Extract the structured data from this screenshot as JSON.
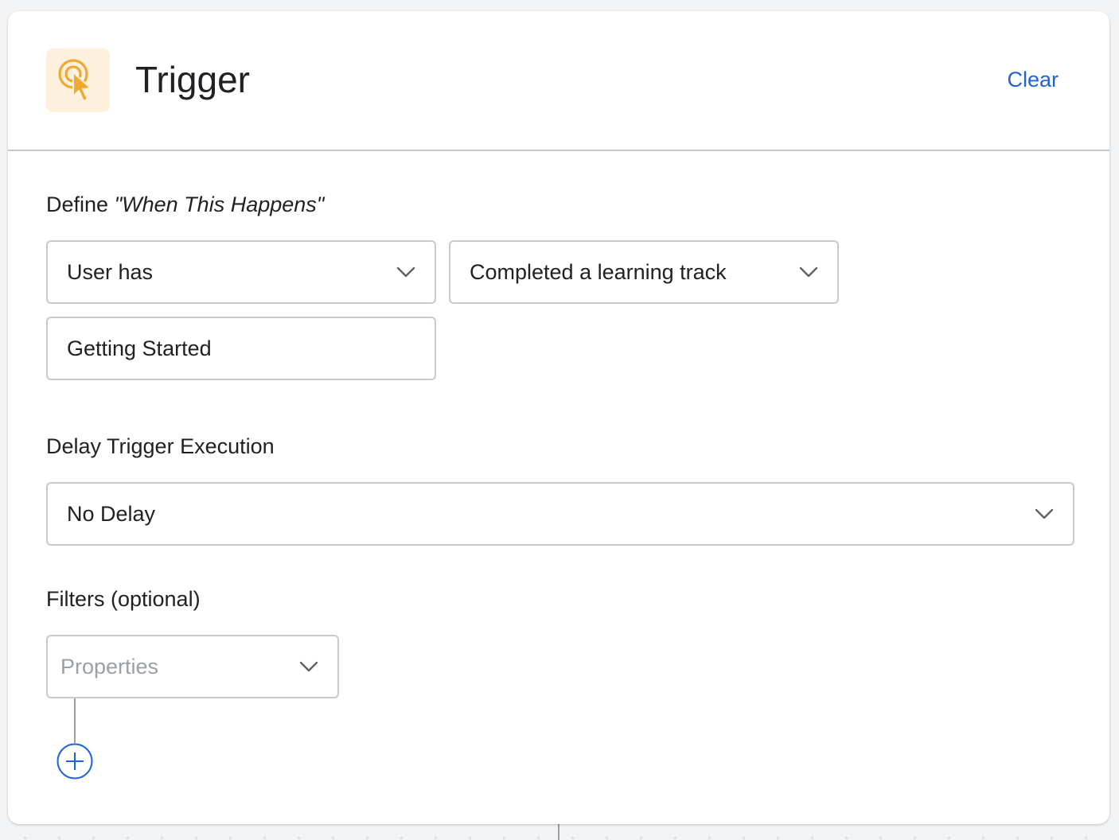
{
  "header": {
    "title": "Trigger",
    "clear_label": "Clear",
    "icon": "trigger-cursor-icon",
    "icon_color": "#f0a830",
    "icon_bg": "#fdf1dd"
  },
  "when_section": {
    "label_prefix": "Define ",
    "label_emphasis": "\"When This Happens\"",
    "subject_select": {
      "value": "User has",
      "icon": "chevron-down-icon"
    },
    "event_select": {
      "value": "Completed a learning track",
      "icon": "chevron-down-icon"
    },
    "track_field": {
      "value": "Getting Started"
    }
  },
  "delay_section": {
    "label": "Delay Trigger Execution",
    "delay_select": {
      "value": "No Delay",
      "icon": "chevron-down-icon"
    }
  },
  "filters_section": {
    "label": "Filters (optional)",
    "properties_select": {
      "placeholder": "Properties",
      "icon": "chevron-down-icon"
    },
    "add_filter_icon": "plus-circle-icon"
  },
  "colors": {
    "accent_blue": "#1f63d6",
    "border": "#c6c9ce",
    "text": "#202124",
    "placeholder": "#9aa0a6"
  }
}
